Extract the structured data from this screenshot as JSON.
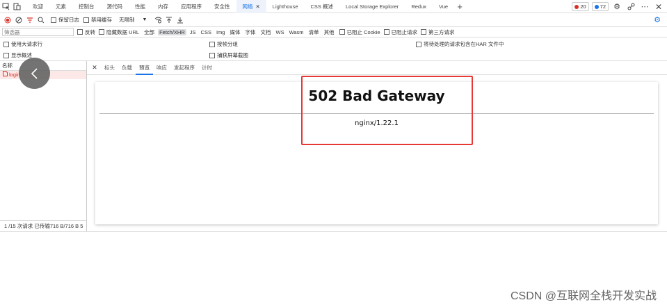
{
  "tabs": [
    {
      "label": "欢迎",
      "active": false
    },
    {
      "label": "元素",
      "active": false
    },
    {
      "label": "控制台",
      "active": false
    },
    {
      "label": "源代码",
      "active": false
    },
    {
      "label": "性能",
      "active": false
    },
    {
      "label": "内存",
      "active": false
    },
    {
      "label": "应用程序",
      "active": false
    },
    {
      "label": "安全性",
      "active": false
    },
    {
      "label": "网络",
      "active": true
    },
    {
      "label": "Lighthouse",
      "active": false
    },
    {
      "label": "CSS 概述",
      "active": false
    },
    {
      "label": "Local Storage Explorer",
      "active": false
    },
    {
      "label": "Redux",
      "active": false
    },
    {
      "label": "Vue",
      "active": false
    }
  ],
  "badges": {
    "errors": "20",
    "messages": "72",
    "error_color": "#d93025",
    "message_color": "#1a73e8"
  },
  "toolbar1": {
    "preserve_log": "保留日志",
    "disable_cache": "禁用缓存",
    "throttling": "无限制"
  },
  "toolbar2": {
    "filter_placeholder": "筛选器",
    "invert": "反转",
    "hide_data_urls": "隐藏数据 URL",
    "chips": [
      "全部",
      "Fetch/XHR",
      "JS",
      "CSS",
      "Img",
      "媒体",
      "字体",
      "文档",
      "WS",
      "Wasm",
      "清单",
      "其他"
    ],
    "active_chip": "Fetch/XHR",
    "blocked_cookies": "已阻止 Cookie",
    "blocked_requests": "已阻止请求",
    "third_party": "第三方请求"
  },
  "settings": {
    "large_rows": "使用大请求行",
    "show_overview": "显示概述",
    "group_by_frame": "按帧分组",
    "capture_screenshots": "捕获屏幕截图",
    "har_pending": "将待处理的请求包含在HAR 文件中"
  },
  "request_list": {
    "column_name": "名称",
    "requests": [
      {
        "name": "login",
        "status_color": "#d93025"
      }
    ],
    "status_bar": "1 /15 次请求  已传输716 B/716 B  5"
  },
  "detail_tabs": [
    {
      "label": "标头",
      "active": false
    },
    {
      "label": "负载",
      "active": false
    },
    {
      "label": "预览",
      "active": true
    },
    {
      "label": "响应",
      "active": false
    },
    {
      "label": "发起程序",
      "active": false
    },
    {
      "label": "计时",
      "active": false
    }
  ],
  "preview": {
    "heading": "502 Bad Gateway",
    "server": "nginx/1.22.1"
  },
  "watermark": "CSDN @互联网全栈开发实战"
}
